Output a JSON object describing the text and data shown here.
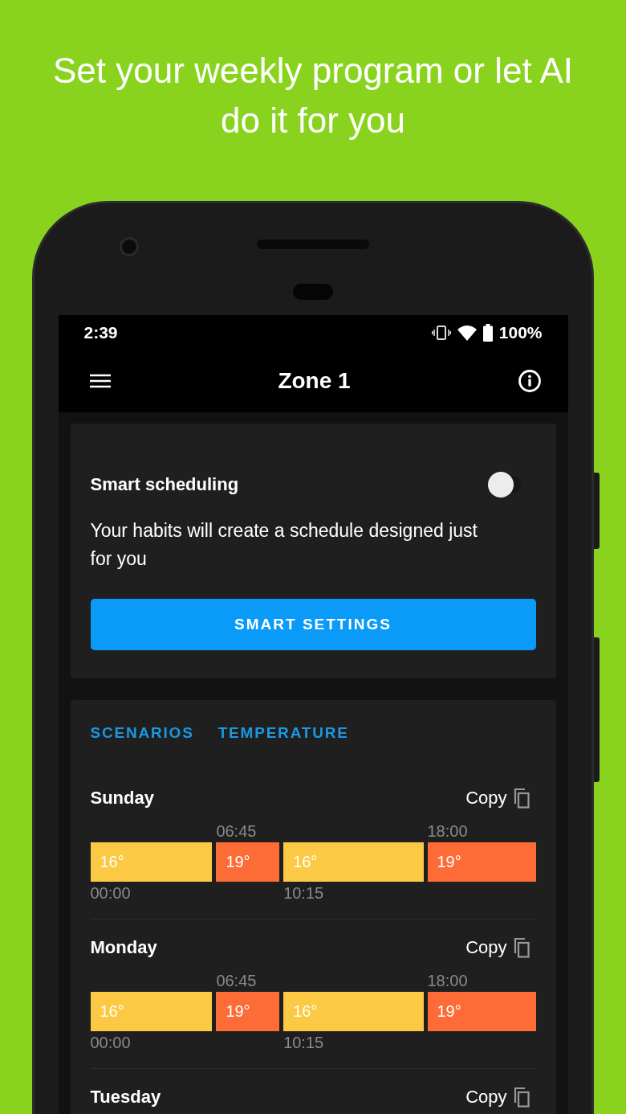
{
  "headline": "Set your weekly program or let AI do it for you",
  "status_bar": {
    "time": "2:39",
    "battery": "100%"
  },
  "app_bar": {
    "title": "Zone 1"
  },
  "smart": {
    "title": "Smart scheduling",
    "on": false,
    "description": "Your habits will create a schedule designed just for you",
    "button": "SMART SETTINGS"
  },
  "tabs": [
    {
      "label": "SCENARIOS"
    },
    {
      "label": "TEMPERATURE"
    }
  ],
  "days": [
    {
      "name": "Sunday",
      "copy": "Copy",
      "segments": [
        {
          "temp": "16°",
          "start": "00:00",
          "label_above": false,
          "color": "#fbc943"
        },
        {
          "temp": "19°",
          "start": "06:45",
          "label_above": true,
          "color": "#fd6b36"
        },
        {
          "temp": "16°",
          "start": "10:15",
          "label_above": false,
          "color": "#fbc943"
        },
        {
          "temp": "19°",
          "start": "18:00",
          "label_above": true,
          "color": "#fd6b36"
        }
      ]
    },
    {
      "name": "Monday",
      "copy": "Copy",
      "segments": [
        {
          "temp": "16°",
          "start": "00:00",
          "label_above": false,
          "color": "#fbc943"
        },
        {
          "temp": "19°",
          "start": "06:45",
          "label_above": true,
          "color": "#fd6b36"
        },
        {
          "temp": "16°",
          "start": "10:15",
          "label_above": false,
          "color": "#fbc943"
        },
        {
          "temp": "19°",
          "start": "18:00",
          "label_above": true,
          "color": "#fd6b36"
        }
      ]
    },
    {
      "name": "Tuesday",
      "copy": "Copy"
    }
  ]
}
